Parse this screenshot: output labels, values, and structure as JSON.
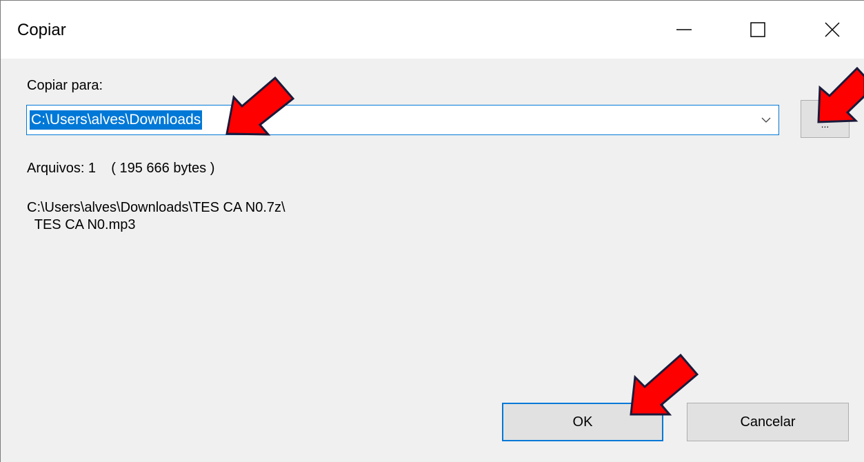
{
  "window": {
    "title": "Copiar",
    "controls": {
      "minimize_icon": "minimize-icon",
      "maximize_icon": "maximize-icon",
      "close_icon": "close-icon"
    }
  },
  "form": {
    "destination_label": "Copiar para:",
    "destination_value": "C:\\Users\\alves\\Downloads",
    "browse_label": "...",
    "files_info": "Arquivos: 1    ( 195 666 bytes )",
    "source_path_line1": "C:\\Users\\alves\\Downloads\\TES CA N0.7z\\",
    "source_path_line2": "  TES CA N0.mp3"
  },
  "buttons": {
    "ok": "OK",
    "cancel": "Cancelar"
  },
  "annotations": {
    "arrow_color": "#ff0000",
    "arrow_outline": "#1a1a3a",
    "arrow_icons": [
      "red-arrow-icon",
      "red-arrow-icon",
      "red-arrow-icon"
    ]
  },
  "colors": {
    "accent": "#0078d7",
    "dialog_bg": "#f0f0f0",
    "button_bg": "#e1e1e1"
  }
}
